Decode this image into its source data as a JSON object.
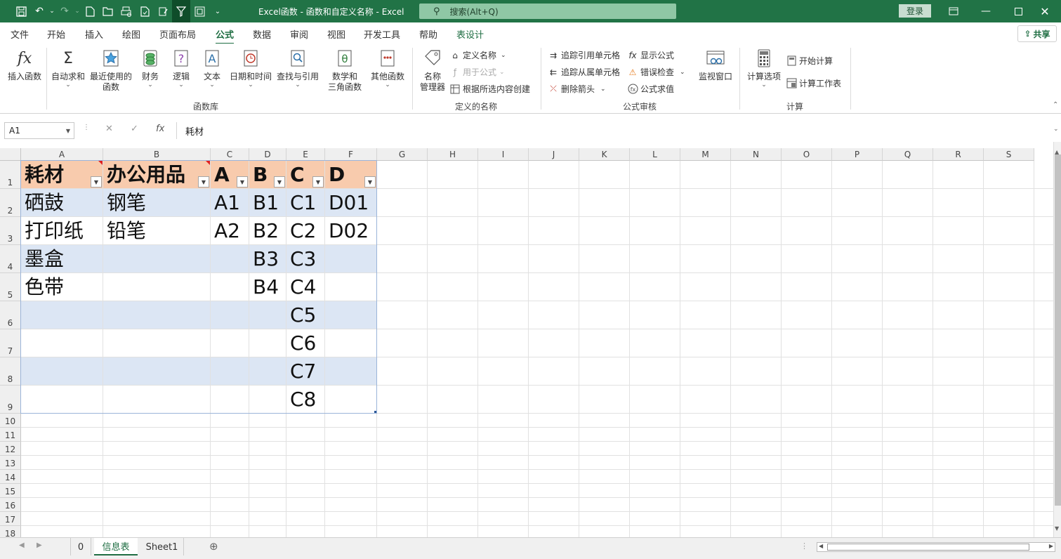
{
  "titlebar": {
    "title": "Excel函数 - 函数和自定义名称  -  Excel",
    "search_placeholder": "搜索(Alt+Q)",
    "login": "登录",
    "icons": [
      "save-icon",
      "undo-icon",
      "redo-icon",
      "new-icon",
      "open-icon",
      "print-preview-icon",
      "print-icon",
      "form-icon",
      "filter-icon",
      "layout-icon",
      "customize-icon"
    ]
  },
  "menu": {
    "tabs": [
      "文件",
      "开始",
      "插入",
      "绘图",
      "页面布局",
      "公式",
      "数据",
      "审阅",
      "视图",
      "开发工具",
      "帮助",
      "表设计"
    ],
    "active": "公式",
    "share": "共享"
  },
  "ribbon": {
    "library": {
      "insert_fn": "插入函数",
      "autosum": "自动求和",
      "recent_1": "最近使用的",
      "recent_2": "函数",
      "financial": "财务",
      "logical": "逻辑",
      "text": "文本",
      "datetime": "日期和时间",
      "lookup": "查找与引用",
      "math_1": "数学和",
      "math_2": "三角函数",
      "more": "其他函数",
      "group": "函数库"
    },
    "names": {
      "manager_1": "名称",
      "manager_2": "管理器",
      "define": "定义名称",
      "use_in_formula": "用于公式",
      "create_from_sel": "根据所选内容创建",
      "group": "定义的名称"
    },
    "audit": {
      "trace_precedents": "追踪引用单元格",
      "trace_dependents": "追踪从属单元格",
      "remove_arrows": "删除箭头",
      "show_formulas": "显示公式",
      "error_check": "错误检查",
      "evaluate": "公式求值",
      "watch": "监视窗口",
      "group": "公式审核"
    },
    "calc": {
      "options": "计算选项",
      "calc_now": "开始计算",
      "calc_sheet": "计算工作表",
      "group": "计算"
    }
  },
  "formula_bar": {
    "name_box": "A1",
    "content": "耗材"
  },
  "sheet": {
    "columns": [
      "A",
      "B",
      "C",
      "D",
      "E",
      "F",
      "G",
      "H",
      "I",
      "J",
      "K",
      "L",
      "M",
      "N",
      "O",
      "P",
      "Q",
      "R",
      "S"
    ],
    "rows": [
      "1",
      "2",
      "3",
      "4",
      "5",
      "6",
      "7",
      "8",
      "9",
      "10",
      "11",
      "12",
      "13",
      "14",
      "15",
      "16",
      "17",
      "18"
    ],
    "table": {
      "headers": [
        "耗材",
        "办公用品",
        "A",
        "B",
        "C",
        "D"
      ],
      "rows": [
        [
          "硒鼓",
          "钢笔",
          "A1",
          "B1",
          "C1",
          "D01"
        ],
        [
          "打印纸",
          "铅笔",
          "A2",
          "B2",
          "C2",
          "D02"
        ],
        [
          "墨盒",
          "",
          "",
          "B3",
          "C3",
          ""
        ],
        [
          "色带",
          "",
          "",
          "B4",
          "C4",
          ""
        ],
        [
          "",
          "",
          "",
          "",
          "C5",
          ""
        ],
        [
          "",
          "",
          "",
          "",
          "C6",
          ""
        ],
        [
          "",
          "",
          "",
          "",
          "C7",
          ""
        ],
        [
          "",
          "",
          "",
          "",
          "C8",
          ""
        ]
      ]
    }
  },
  "sheet_tabs": {
    "tabs": [
      "0",
      "信息表",
      "Sheet1"
    ],
    "active": "信息表"
  },
  "colors": {
    "excel_green": "#217346",
    "table_header": "#f8cbad",
    "table_band": "#dce6f4"
  }
}
